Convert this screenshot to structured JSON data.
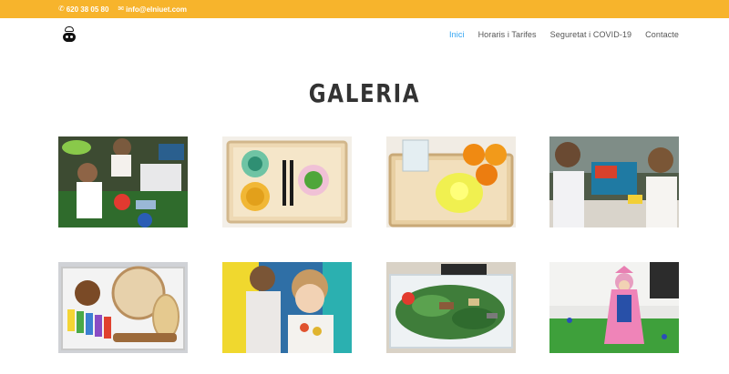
{
  "topbar": {
    "phone_icon": "phone-icon",
    "phone": "620 38 05 80",
    "email_icon": "envelope-icon",
    "email": "info@elniuet.com"
  },
  "header": {
    "logo": "el-niuet-logo",
    "nav": [
      {
        "label": "Inici",
        "active": true
      },
      {
        "label": "Horaris i Tarifes",
        "active": false
      },
      {
        "label": "Seguretat i COVID-19",
        "active": false
      },
      {
        "label": "Contacte",
        "active": false
      }
    ]
  },
  "page": {
    "title": "GALERIA"
  },
  "gallery": {
    "images": [
      {
        "subject": "children playing with toys on table"
      },
      {
        "subject": "wooden tray with bowls and tongs"
      },
      {
        "subject": "wooden tray with oranges and juicer"
      },
      {
        "subject": "two children at water table"
      },
      {
        "subject": "box of musical instruments"
      },
      {
        "subject": "two children playing indoors"
      },
      {
        "subject": "sensory bin with toy animals and leaves"
      },
      {
        "subject": "child in pink costume on grass"
      }
    ]
  },
  "colors": {
    "topbar": "#f7b42c",
    "nav_active": "#2ea3f2",
    "nav_text": "#555555",
    "title": "#333333"
  }
}
